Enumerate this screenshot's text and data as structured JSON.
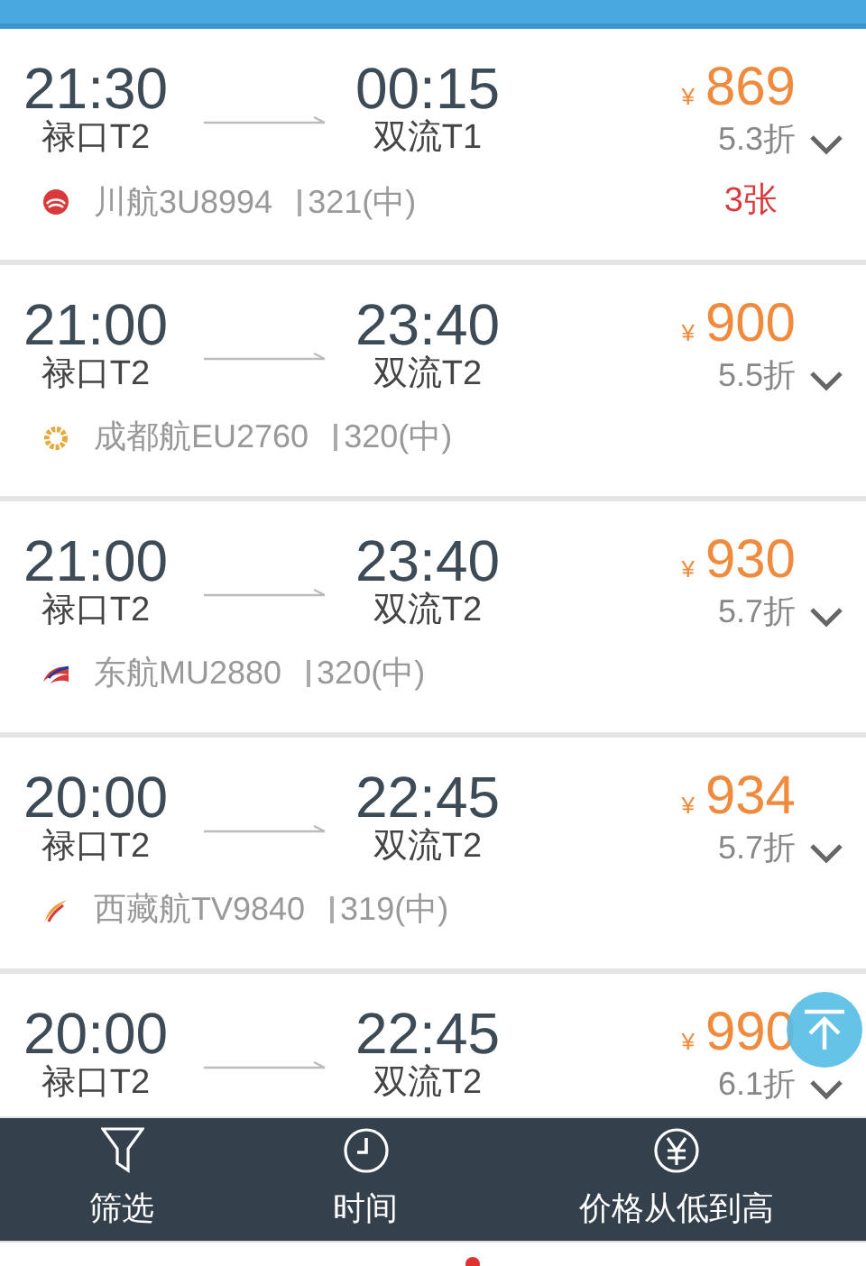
{
  "flights": [
    {
      "dep_time": "21:30",
      "dep_airport": "禄口T2",
      "arr_time": "00:15",
      "arr_airport": "双流T1",
      "currency": "¥",
      "price": "869",
      "discount": "5.3折",
      "logo": {
        "kind": "sichuan"
      },
      "airline": "川航3U8994",
      "aircraft": "321(中)",
      "tickets": "3张"
    },
    {
      "dep_time": "21:00",
      "dep_airport": "禄口T2",
      "arr_time": "23:40",
      "arr_airport": "双流T2",
      "currency": "¥",
      "price": "900",
      "discount": "5.5折",
      "logo": {
        "kind": "chengdu"
      },
      "airline": "成都航EU2760",
      "aircraft": "320(中)"
    },
    {
      "dep_time": "21:00",
      "dep_airport": "禄口T2",
      "arr_time": "23:40",
      "arr_airport": "双流T2",
      "currency": "¥",
      "price": "930",
      "discount": "5.7折",
      "logo": {
        "kind": "eastern"
      },
      "airline": "东航MU2880",
      "aircraft": "320(中)"
    },
    {
      "dep_time": "20:00",
      "dep_airport": "禄口T2",
      "arr_time": "22:45",
      "arr_airport": "双流T2",
      "currency": "¥",
      "price": "934",
      "discount": "5.7折",
      "logo": {
        "kind": "tibet"
      },
      "airline": "西藏航TV9840",
      "aircraft": "319(中)"
    },
    {
      "dep_time": "20:00",
      "dep_airport": "禄口T2",
      "arr_time": "22:45",
      "arr_airport": "双流T2",
      "currency": "¥",
      "price": "990",
      "discount": "6.1折"
    }
  ],
  "bottom_bar": [
    {
      "kind": "filter",
      "label": "筛选"
    },
    {
      "kind": "clock",
      "label": "时间"
    },
    {
      "kind": "yen",
      "label": "价格从低到高"
    }
  ]
}
